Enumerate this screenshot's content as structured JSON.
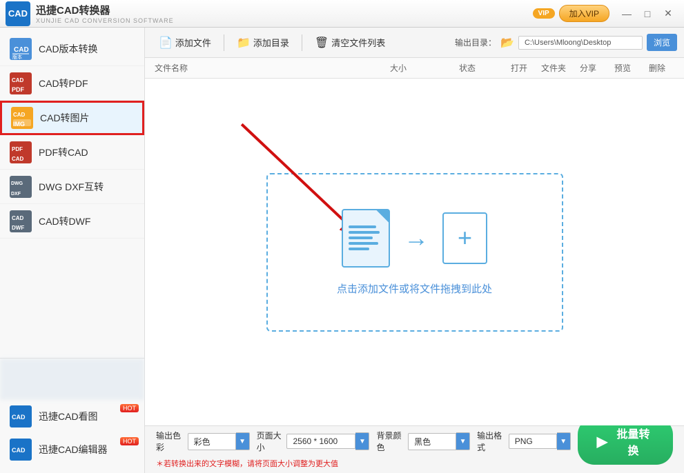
{
  "app": {
    "logo_text": "CAD",
    "title": "迅捷CAD转换器",
    "subtitle": "XUNJIE CAD CONVERSION SOFTWARE"
  },
  "vip": {
    "badge": "VIP",
    "join_label": "加入VIP"
  },
  "win_controls": {
    "minimize": "—",
    "maximize": "□",
    "close": "✕"
  },
  "sidebar": {
    "items": [
      {
        "id": "cad-version",
        "label": "CAD版本转换",
        "active": false
      },
      {
        "id": "cad-pdf",
        "label": "CAD转PDF",
        "active": false
      },
      {
        "id": "cad-img",
        "label": "CAD转图片",
        "active": true
      },
      {
        "id": "pdf-cad",
        "label": "PDF转CAD",
        "active": false
      },
      {
        "id": "dwg-dxf",
        "label": "DWG DXF互转",
        "active": false
      },
      {
        "id": "cad-dwf",
        "label": "CAD转DWF",
        "active": false
      }
    ],
    "bottom_items": [
      {
        "id": "cad-viewer",
        "label": "迅捷CAD看图",
        "hot": true
      },
      {
        "id": "cad-editor",
        "label": "迅捷CAD编辑器",
        "hot": true
      }
    ]
  },
  "toolbar": {
    "add_file": "添加文件",
    "add_dir": "添加目录",
    "clear_list": "清空文件列表",
    "output_dir_label": "输出目录：",
    "output_path": "C:\\Users\\Mloong\\Desktop",
    "browse": "浏览"
  },
  "file_list": {
    "col_name": "文件名称",
    "col_size": "大小",
    "col_status": "状态",
    "col_open": "打开",
    "col_folder": "文件夹",
    "col_share": "分享",
    "col_preview": "预览",
    "col_delete": "删除"
  },
  "drop_zone": {
    "text": "点击添加文件或将文件拖拽到此处"
  },
  "settings": {
    "color_label": "输出色彩",
    "color_value": "彩色",
    "page_label": "页面大小",
    "page_value": "2560 * 1600",
    "bg_label": "背景颜色",
    "bg_value": "黑色",
    "format_label": "输出格式",
    "format_value": "PNG"
  },
  "hint": "＊若转换出来的文字模糊，请将页面大小调整为更大值",
  "convert_btn": "批量转换"
}
